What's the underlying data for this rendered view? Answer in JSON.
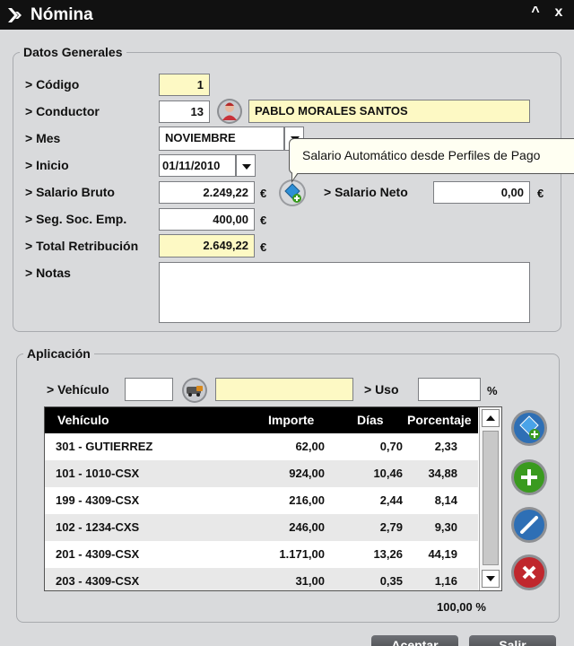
{
  "window": {
    "title": "Nómina",
    "btn_min": "^",
    "btn_close": "x"
  },
  "datos": {
    "legend": "Datos Generales",
    "codigo": {
      "label": "> Código",
      "value": "1"
    },
    "conductor": {
      "label": "> Conductor",
      "value": "13",
      "name": "PABLO MORALES SANTOS"
    },
    "mes": {
      "label": "> Mes",
      "value": "NOVIEMBRE"
    },
    "inicio": {
      "label": "> Inicio",
      "value": "01/11/2010"
    },
    "salario_bruto": {
      "label": "> Salario Bruto",
      "value": "2.249,22"
    },
    "salario_neto": {
      "label": "> Salario Neto",
      "value": "0,00"
    },
    "seg_soc": {
      "label": "> Seg. Soc. Emp.",
      "value": "400,00"
    },
    "total": {
      "label": "> Total Retribución",
      "value": "2.649,22"
    },
    "notas": {
      "label": "> Notas",
      "value": ""
    },
    "currency": "€",
    "tooltip": "Salario Automático desde Perfiles de Pago"
  },
  "aplicacion": {
    "legend": "Aplicación",
    "vehiculo_label": "> Vehículo",
    "vehiculo_value": "",
    "vehiculo_name": "",
    "uso_label": "> Uso",
    "uso_value": "",
    "percent": "%",
    "columns": [
      "Vehículo",
      "Importe",
      "Días",
      "Porcentaje"
    ],
    "rows": [
      [
        "301 - GUTIERREZ",
        "62,00",
        "0,70",
        "2,33"
      ],
      [
        "101 - 1010-CSX",
        "924,00",
        "10,46",
        "34,88"
      ],
      [
        "199 - 4309-CSX",
        "216,00",
        "2,44",
        "8,14"
      ],
      [
        "102 - 1234-CXS",
        "246,00",
        "2,79",
        "9,30"
      ],
      [
        "201 - 4309-CSX",
        "1.171,00",
        "13,26",
        "44,19"
      ],
      [
        "203 - 4309-CSX",
        "31,00",
        "0,35",
        "1,16"
      ]
    ],
    "total_percent": "100,00 %"
  },
  "footer": {
    "accept": "Aceptar",
    "exit": "Salir"
  },
  "colors": {
    "titlebar": "#111111",
    "highlight_field": "#fdf9c4",
    "green": "#3a9a1f",
    "red": "#c0272d",
    "blue": "#2e6fb5"
  }
}
